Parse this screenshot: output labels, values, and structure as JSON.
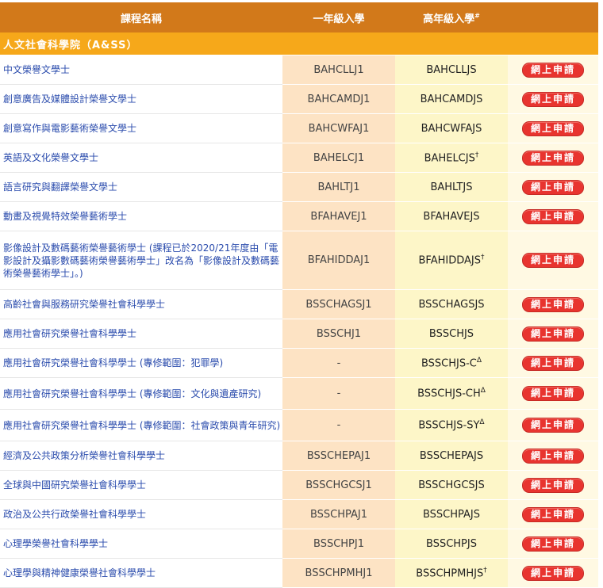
{
  "header": {
    "col_name": "課程名稱",
    "col_year1": "一年級入學",
    "col_senior": "高年級入學",
    "col_senior_mark": "#"
  },
  "group": {
    "label": "人文社會科學院（A&SS）"
  },
  "apply_label": "網上申請",
  "rows": [
    {
      "name": "中文榮譽文學士",
      "code1": "BAHCLLJ1",
      "code2": "BAHCLLJS",
      "mark": ""
    },
    {
      "name": "創意廣告及媒體設計榮譽文學士",
      "code1": "BAHCAMDJ1",
      "code2": "BAHCAMDJS",
      "mark": ""
    },
    {
      "name": "創意寫作與電影藝術榮譽文學士",
      "code1": "BAHCWFAJ1",
      "code2": "BAHCWFAJS",
      "mark": ""
    },
    {
      "name": "英語及文化榮譽文學士",
      "code1": "BAHELCJ1",
      "code2": "BAHELCJS",
      "mark": "†"
    },
    {
      "name": "語言研究與翻譯榮譽文學士",
      "code1": "BAHLTJ1",
      "code2": "BAHLTJS",
      "mark": ""
    },
    {
      "name": "動畫及視覺特效榮譽藝術學士",
      "code1": "BFAHAVEJ1",
      "code2": "BFAHAVEJS",
      "mark": ""
    },
    {
      "name": "影像設計及數碼藝術榮譽藝術學士 (課程已於2020/21年度由「電影設計及攝影數碼藝術榮譽藝術學士」改名為「影像設計及數碼藝術榮譽藝術學士」。)",
      "code1": "BFAHIDDAJ1",
      "code2": "BFAHIDDAJS",
      "mark": "†"
    },
    {
      "name": "高齡社會與服務研究榮譽社會科學學士",
      "code1": "BSSCHAGSJ1",
      "code2": "BSSCHAGSJS",
      "mark": ""
    },
    {
      "name": "應用社會研究榮譽社會科學學士",
      "code1": "BSSCHJ1",
      "code2": "BSSCHJS",
      "mark": ""
    },
    {
      "name": "應用社會研究榮譽社會科學學士 (專修範圍：犯罪學)",
      "code1": "-",
      "code2": "BSSCHJS-C",
      "mark": "Δ"
    },
    {
      "name": "應用社會研究榮譽社會科學學士 (專修範圍：文化與遺產研究)",
      "code1": "-",
      "code2": "BSSCHJS-CH",
      "mark": "Δ"
    },
    {
      "name": "應用社會研究榮譽社會科學學士 (專修範圍：社會政策與青年研究)",
      "code1": "-",
      "code2": "BSSCHJS-SY",
      "mark": "Δ"
    },
    {
      "name": "經濟及公共政策分析榮譽社會科學學士",
      "code1": "BSSCHEPAJ1",
      "code2": "BSSCHEPAJS",
      "mark": ""
    },
    {
      "name": "全球與中國研究榮譽社會科學學士",
      "code1": "BSSCHGCSJ1",
      "code2": "BSSCHGCSJS",
      "mark": ""
    },
    {
      "name": "政治及公共行政榮譽社會科學學士",
      "code1": "BSSCHPAJ1",
      "code2": "BSSCHPAJS",
      "mark": ""
    },
    {
      "name": "心理學榮譽社會科學學士",
      "code1": "BSSCHPJ1",
      "code2": "BSSCHPJS",
      "mark": ""
    },
    {
      "name": "心理學與精神健康榮譽社會科學學士",
      "code1": "BSSCHPMHJ1",
      "code2": "BSSCHPMHJS",
      "mark": "†"
    }
  ]
}
